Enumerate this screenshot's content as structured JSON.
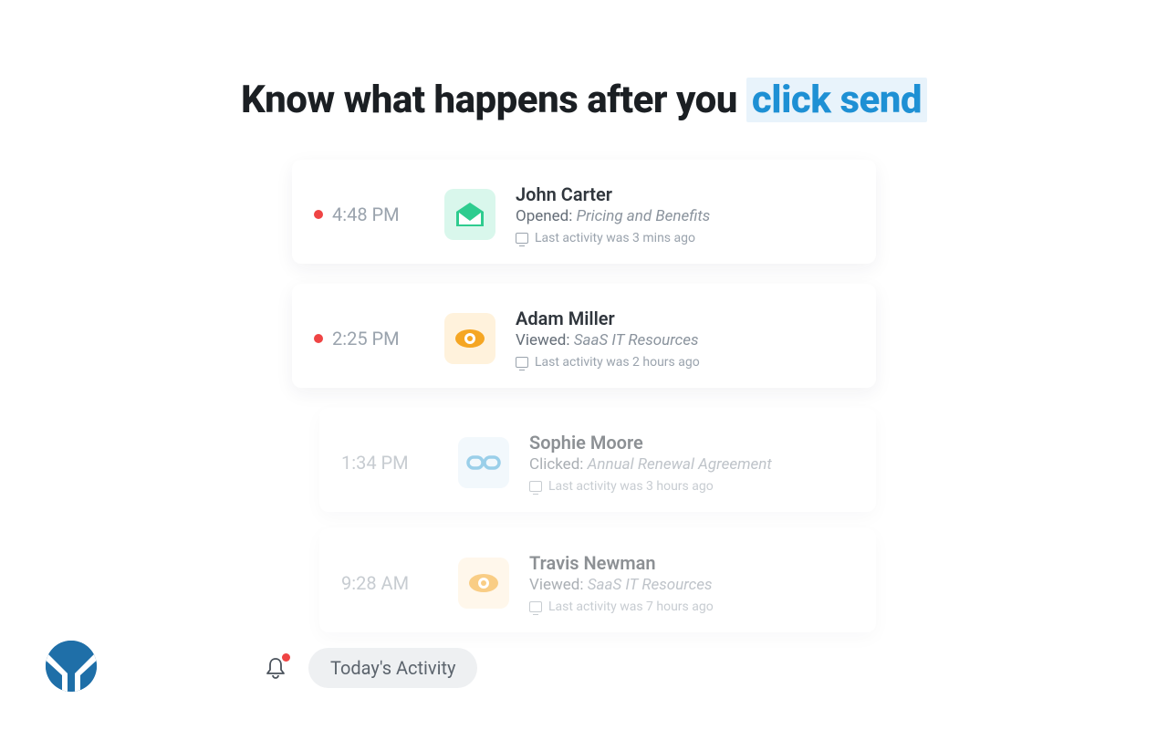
{
  "title": {
    "prefix": "Know what happens after you ",
    "highlight": "click send"
  },
  "feed": [
    {
      "time": "4:48 PM",
      "unread": true,
      "icon": "open",
      "name": "John Carter",
      "action": "Opened:",
      "subject": "Pricing and Benefits",
      "activity": "Last activity was 3 mins ago",
      "faded": false
    },
    {
      "time": "2:25 PM",
      "unread": true,
      "icon": "view",
      "name": "Adam Miller",
      "action": "Viewed:",
      "subject": "SaaS IT Resources",
      "activity": "Last activity was 2 hours ago",
      "faded": false
    },
    {
      "time": "1:34 PM",
      "unread": false,
      "icon": "link",
      "name": "Sophie Moore",
      "action": "Clicked:",
      "subject": "Annual Renewal Agreement",
      "activity": "Last activity was 3 hours ago",
      "faded": true
    },
    {
      "time": "9:28 AM",
      "unread": false,
      "icon": "view",
      "name": "Travis Newman",
      "action": "Viewed:",
      "subject": "SaaS IT Resources",
      "activity": "Last activity was 7 hours ago",
      "faded": true
    }
  ],
  "pill": "Today's Activity",
  "colors": {
    "accent": "#1E90D4",
    "danger": "#ef4444",
    "green": "#2ecc8f",
    "orange": "#f5a623",
    "blue": "#49a8d8"
  }
}
